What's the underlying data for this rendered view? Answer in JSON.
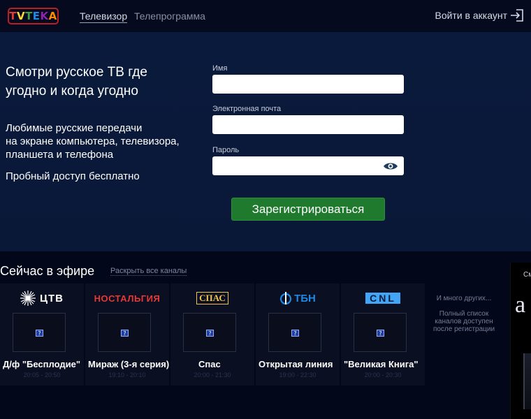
{
  "header": {
    "logo_letters": [
      "T",
      "V",
      "T",
      "E",
      "K",
      "A"
    ],
    "logo_colors": [
      "#e53935",
      "#fdd835",
      "#43a047",
      "#1e88e5",
      "#8e24aa",
      "#fb8c00"
    ],
    "nav": [
      {
        "label": "Телевизор",
        "active": true
      },
      {
        "label": "Телепрограмма",
        "active": false
      }
    ],
    "login_label": "Войти в аккаунт"
  },
  "hero": {
    "title": "Смотри русское ТВ где угодно и когда угодно",
    "description_lines": [
      "Любимые русские передачи",
      "на экране компьютера, телевизора,",
      "планшета и телефона"
    ],
    "trial": "Пробный доступ бесплатно"
  },
  "form": {
    "name_label": "Имя",
    "email_label": "Электронная почта",
    "password_label": "Пароль",
    "submit_label": "Зарегистрироваться"
  },
  "live": {
    "title": "Сейчас в эфире",
    "expand_label": "Раскрыть все каналы",
    "channels": [
      {
        "logo": "ЦТВ",
        "show": "Д/ф \"Бесплодие\"",
        "time": "20:05 - 20:50",
        "logo_color": "#ffffff"
      },
      {
        "logo": "НОСТАЛЬГИЯ",
        "show": "Мираж (3-я серия)",
        "time": "19:10 - 20:10",
        "logo_color": "#e53935"
      },
      {
        "logo": "СПАС",
        "show": "Спас",
        "time": "20:00 - 21:30",
        "logo_color": "#f2c14e"
      },
      {
        "logo": "ТБН",
        "show": "Открытая линия",
        "time": "19:00 - 22:30",
        "logo_color": "#1e88e5"
      },
      {
        "logo": "CNL",
        "show": "\"Великая Книга\"",
        "time": "20:00 - 20:30",
        "logo_color": "#42a5f5"
      }
    ],
    "more_title": "И много других...",
    "more_desc": "Полный список каналов доступен после регистрации",
    "promo_text": "См",
    "promo_big": "a"
  }
}
